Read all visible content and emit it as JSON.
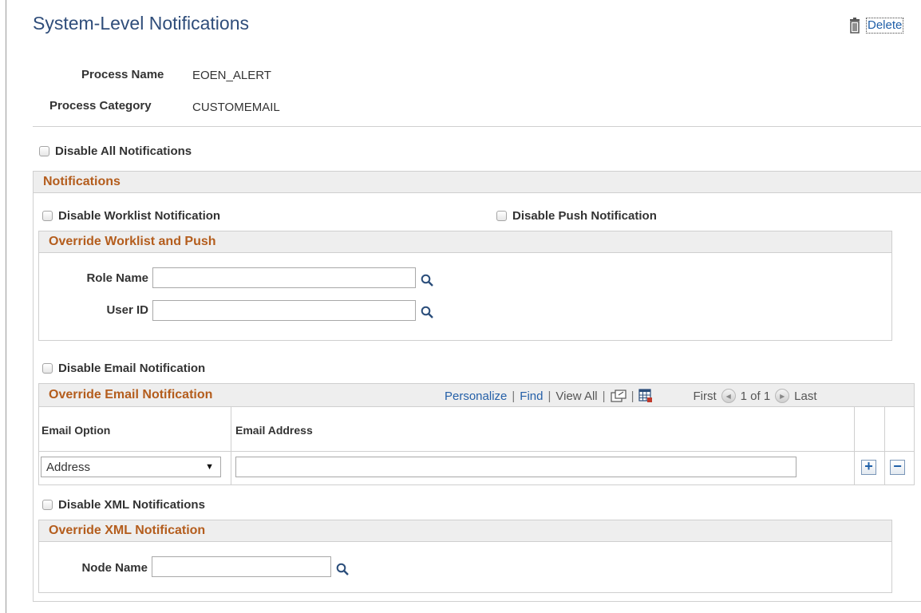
{
  "page": {
    "title": "System-Level Notifications",
    "delete_label": "Delete"
  },
  "process": {
    "name_label": "Process Name",
    "name_value": "EOEN_ALERT",
    "category_label": "Process Category",
    "category_value": "CUSTOMEMAIL"
  },
  "disable_all_label": "Disable All Notifications",
  "notifications": {
    "header": "Notifications",
    "disable_worklist_label": "Disable Worklist Notification",
    "disable_push_label": "Disable Push Notification",
    "override_worklist": {
      "header": "Override Worklist and Push",
      "role_name_label": "Role Name",
      "role_name_value": "",
      "user_id_label": "User ID",
      "user_id_value": ""
    },
    "disable_email_label": "Disable Email Notification",
    "override_email": {
      "header": "Override Email Notification",
      "toolbar": {
        "personalize": "Personalize",
        "find": "Find",
        "view_all": "View All",
        "first": "First",
        "page_info": "1 of 1",
        "last": "Last"
      },
      "columns": [
        "Email Option",
        "Email Address"
      ],
      "rows": [
        {
          "email_option": "Address",
          "email_address": ""
        }
      ]
    },
    "disable_xml_label": "Disable XML Notifications",
    "override_xml": {
      "header": "Override XML Notification",
      "node_name_label": "Node Name",
      "node_name_value": ""
    }
  },
  "icons": {
    "delete": "trash-icon",
    "lookup": "magnifier-icon",
    "zoom": "new-window-icon",
    "download": "spreadsheet-icon",
    "prev": "left-arrow-icon",
    "next": "right-arrow-icon",
    "add_row": "plus-icon",
    "delete_row": "minus-icon",
    "dropdown": "caret-down-icon"
  },
  "colors": {
    "title": "#2f4d7a",
    "section_header": "#b45d1d",
    "link": "#2560a8"
  }
}
